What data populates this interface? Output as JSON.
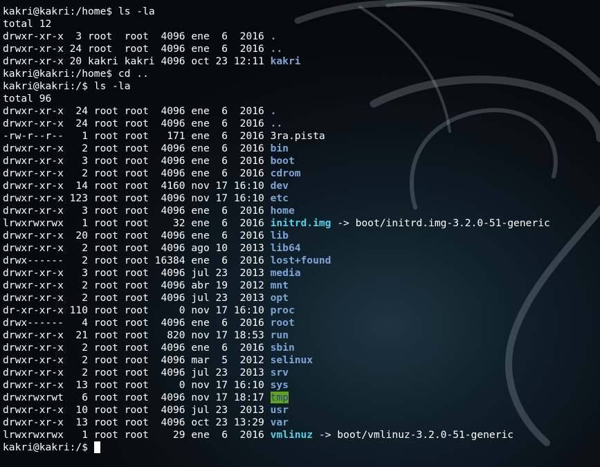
{
  "terminal": {
    "lines": [
      {
        "kind": "text",
        "text": "kakri@kakri:/home$ ls -la"
      },
      {
        "kind": "text",
        "text": "total 12"
      },
      {
        "kind": "entry",
        "prefix": "drwxr-xr-x  3 root  root  4096 ene  6  2016 ",
        "name": ".",
        "style": "dir",
        "suffix": ""
      },
      {
        "kind": "entry",
        "prefix": "drwxr-xr-x 24 root  root  4096 ene  6  2016 ",
        "name": "..",
        "style": "dir",
        "suffix": ""
      },
      {
        "kind": "entry",
        "prefix": "drwxr-xr-x 20 kakri kakri 4096 oct 23 12:11 ",
        "name": "kakri",
        "style": "dir",
        "suffix": ""
      },
      {
        "kind": "text",
        "text": "kakri@kakri:/home$ cd .."
      },
      {
        "kind": "text",
        "text": "kakri@kakri:/$ ls -la"
      },
      {
        "kind": "text",
        "text": "total 96"
      },
      {
        "kind": "entry",
        "prefix": "drwxr-xr-x  24 root root  4096 ene  6  2016 ",
        "name": ".",
        "style": "dir",
        "suffix": ""
      },
      {
        "kind": "entry",
        "prefix": "drwxr-xr-x  24 root root  4096 ene  6  2016 ",
        "name": "..",
        "style": "dir",
        "suffix": ""
      },
      {
        "kind": "entry",
        "prefix": "-rw-r--r--   1 root root   171 ene  6  2016 ",
        "name": "3ra.pista",
        "style": "file",
        "suffix": ""
      },
      {
        "kind": "entry",
        "prefix": "drwxr-xr-x   2 root root  4096 ene  6  2016 ",
        "name": "bin",
        "style": "dir",
        "suffix": ""
      },
      {
        "kind": "entry",
        "prefix": "drwxr-xr-x   3 root root  4096 ene  6  2016 ",
        "name": "boot",
        "style": "dir",
        "suffix": ""
      },
      {
        "kind": "entry",
        "prefix": "drwxr-xr-x   2 root root  4096 ene  6  2016 ",
        "name": "cdrom",
        "style": "dir",
        "suffix": ""
      },
      {
        "kind": "entry",
        "prefix": "drwxr-xr-x  14 root root  4160 nov 17 16:10 ",
        "name": "dev",
        "style": "dir",
        "suffix": ""
      },
      {
        "kind": "entry",
        "prefix": "drwxr-xr-x 123 root root  4096 nov 17 16:10 ",
        "name": "etc",
        "style": "dir",
        "suffix": ""
      },
      {
        "kind": "entry",
        "prefix": "drwxr-xr-x   3 root root  4096 ene  6  2016 ",
        "name": "home",
        "style": "dir",
        "suffix": ""
      },
      {
        "kind": "entry",
        "prefix": "lrwxrwxrwx   1 root root    32 ene  6  2016 ",
        "name": "initrd.img",
        "style": "link",
        "suffix": " -> boot/initrd.img-3.2.0-51-generic"
      },
      {
        "kind": "entry",
        "prefix": "drwxr-xr-x  20 root root  4096 ene  6  2016 ",
        "name": "lib",
        "style": "dir",
        "suffix": ""
      },
      {
        "kind": "entry",
        "prefix": "drwxr-xr-x   2 root root  4096 ago 10  2013 ",
        "name": "lib64",
        "style": "dir",
        "suffix": ""
      },
      {
        "kind": "entry",
        "prefix": "drwx------   2 root root 16384 ene  6  2016 ",
        "name": "lost+found",
        "style": "dir",
        "suffix": ""
      },
      {
        "kind": "entry",
        "prefix": "drwxr-xr-x   3 root root  4096 jul 23  2013 ",
        "name": "media",
        "style": "dir",
        "suffix": ""
      },
      {
        "kind": "entry",
        "prefix": "drwxr-xr-x   2 root root  4096 abr 19  2012 ",
        "name": "mnt",
        "style": "dir",
        "suffix": ""
      },
      {
        "kind": "entry",
        "prefix": "drwxr-xr-x   2 root root  4096 jul 23  2013 ",
        "name": "opt",
        "style": "dir",
        "suffix": ""
      },
      {
        "kind": "entry",
        "prefix": "dr-xr-xr-x 110 root root     0 nov 17 16:10 ",
        "name": "proc",
        "style": "dir",
        "suffix": ""
      },
      {
        "kind": "entry",
        "prefix": "drwx------   4 root root  4096 ene  6  2016 ",
        "name": "root",
        "style": "dir",
        "suffix": ""
      },
      {
        "kind": "entry",
        "prefix": "drwxr-xr-x  21 root root   820 nov 17 18:53 ",
        "name": "run",
        "style": "dir",
        "suffix": ""
      },
      {
        "kind": "entry",
        "prefix": "drwxr-xr-x   2 root root  4096 ene  6  2016 ",
        "name": "sbin",
        "style": "dir",
        "suffix": ""
      },
      {
        "kind": "entry",
        "prefix": "drwxr-xr-x   2 root root  4096 mar  5  2012 ",
        "name": "selinux",
        "style": "dir",
        "suffix": ""
      },
      {
        "kind": "entry",
        "prefix": "drwxr-xr-x   2 root root  4096 jul 23  2013 ",
        "name": "srv",
        "style": "dir",
        "suffix": ""
      },
      {
        "kind": "entry",
        "prefix": "drwxr-xr-x  13 root root     0 nov 17 16:10 ",
        "name": "sys",
        "style": "dir",
        "suffix": ""
      },
      {
        "kind": "entry",
        "prefix": "drwxrwxrwt   6 root root  4096 nov 17 18:17 ",
        "name": "tmp",
        "style": "sticky",
        "suffix": ""
      },
      {
        "kind": "entry",
        "prefix": "drwxr-xr-x  10 root root  4096 jul 23  2013 ",
        "name": "usr",
        "style": "dir",
        "suffix": ""
      },
      {
        "kind": "entry",
        "prefix": "drwxr-xr-x  13 root root  4096 oct 23 13:29 ",
        "name": "var",
        "style": "dir",
        "suffix": ""
      },
      {
        "kind": "entry",
        "prefix": "lrwxrwxrwx   1 root root    29 ene  6  2016 ",
        "name": "vmlinuz",
        "style": "link",
        "suffix": " -> boot/vmlinuz-3.2.0-51-generic"
      },
      {
        "kind": "prompt",
        "text": "kakri@kakri:/$ "
      }
    ]
  },
  "colors": {
    "background": "#07090c",
    "text": "#ffffff",
    "directory": "#7ca6d8",
    "symlink": "#4fd2ea",
    "sticky_fg": "#2b3f8e",
    "sticky_bg": "#5ea51b"
  },
  "icons": {
    "wallpaper": "kali-dragon-icon",
    "cursor": "block-cursor"
  }
}
